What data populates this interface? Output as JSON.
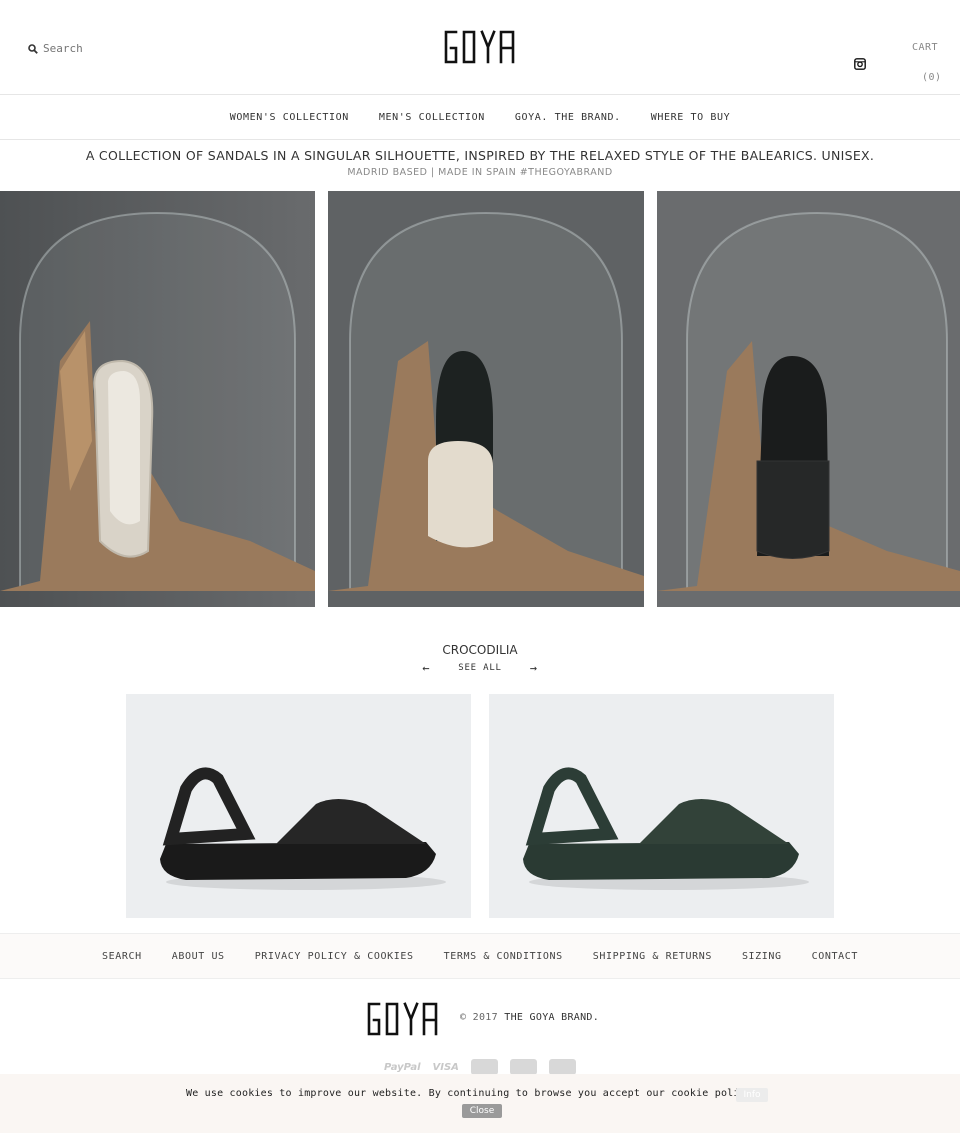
{
  "header": {
    "search_placeholder": "Search",
    "cart_label": "CART",
    "cart_count": "(0)",
    "logo_text": "GOYA"
  },
  "nav": {
    "items": [
      "WOMEN'S COLLECTION",
      "MEN'S COLLECTION",
      "GOYA. THE BRAND.",
      "WHERE TO BUY"
    ]
  },
  "intro": {
    "tagline": "A COLLECTION OF SANDALS IN A SINGULAR SILHOUETTE, INSPIRED BY THE RELAXED STYLE OF THE BALEARICS. UNISEX.",
    "subtagline": "MADRID BASED | MADE IN SPAIN #THEGOYABRAND"
  },
  "collection": {
    "title": "CROCODILIA",
    "prev_arrow": "←",
    "see_all": "SEE ALL",
    "next_arrow": "→"
  },
  "footer": {
    "links": [
      "SEARCH",
      "ABOUT US",
      "PRIVACY POLICY & COOKIES",
      "TERMS & CONDITIONS",
      "SHIPPING & RETURNS",
      "SIZING",
      "CONTACT"
    ],
    "copyright_prefix": "© 2017",
    "copyright_brand": "THE GOYA BRAND.",
    "payments": [
      "PayPal",
      "VISA"
    ]
  },
  "cookie": {
    "message": "We use cookies to improve our website. By continuing to browse you accept our cookie policy.",
    "info_label": "Info",
    "close_label": "Close"
  }
}
